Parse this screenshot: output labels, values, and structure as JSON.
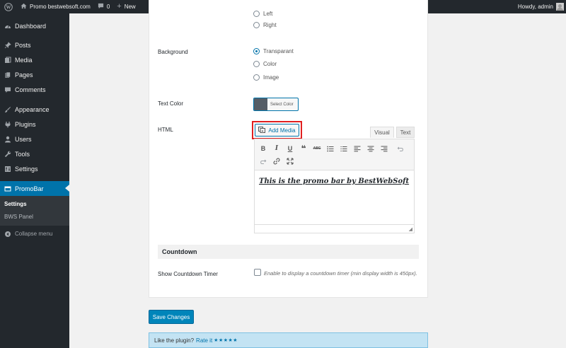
{
  "admin_bar": {
    "site_name": "Promo bestwebsoft.com",
    "comments_count": "0",
    "new_label": "New",
    "greeting": "Howdy, admin"
  },
  "sidebar": {
    "items": [
      {
        "label": "Dashboard",
        "icon": "dashboard-icon"
      },
      {
        "label": "Posts",
        "icon": "pin-icon"
      },
      {
        "label": "Media",
        "icon": "media-icon"
      },
      {
        "label": "Pages",
        "icon": "pages-icon"
      },
      {
        "label": "Comments",
        "icon": "comment-icon"
      },
      {
        "label": "Appearance",
        "icon": "brush-icon"
      },
      {
        "label": "Plugins",
        "icon": "plug-icon"
      },
      {
        "label": "Users",
        "icon": "user-icon"
      },
      {
        "label": "Tools",
        "icon": "wrench-icon"
      },
      {
        "label": "Settings",
        "icon": "settings-icon"
      },
      {
        "label": "PromoBar",
        "icon": "promobar-icon"
      }
    ],
    "submenu": [
      "Settings",
      "BWS Panel"
    ],
    "collapse_label": "Collapse menu"
  },
  "form": {
    "position_options": [
      "Left",
      "Right"
    ],
    "background_label": "Background",
    "background_options": [
      "Transparant",
      "Color",
      "Image"
    ],
    "background_selected": "Transparant",
    "text_color_label": "Text Color",
    "select_color_label": "Select Color",
    "text_color_value": "#555d66",
    "html_label": "HTML",
    "add_media_label": "Add Media",
    "tab_visual": "Visual",
    "tab_text": "Text",
    "editor_content": "This is the promo bar by BestWebSoft",
    "countdown_heading": "Countdown",
    "countdown_label": "Show Countdown Timer",
    "countdown_desc": "Enable to display a countdown timer (min display width is 450px)."
  },
  "save_label": "Save Changes",
  "notice": {
    "text": "Like the plugin?",
    "link": "Rate it",
    "stars": "★★★★★"
  }
}
